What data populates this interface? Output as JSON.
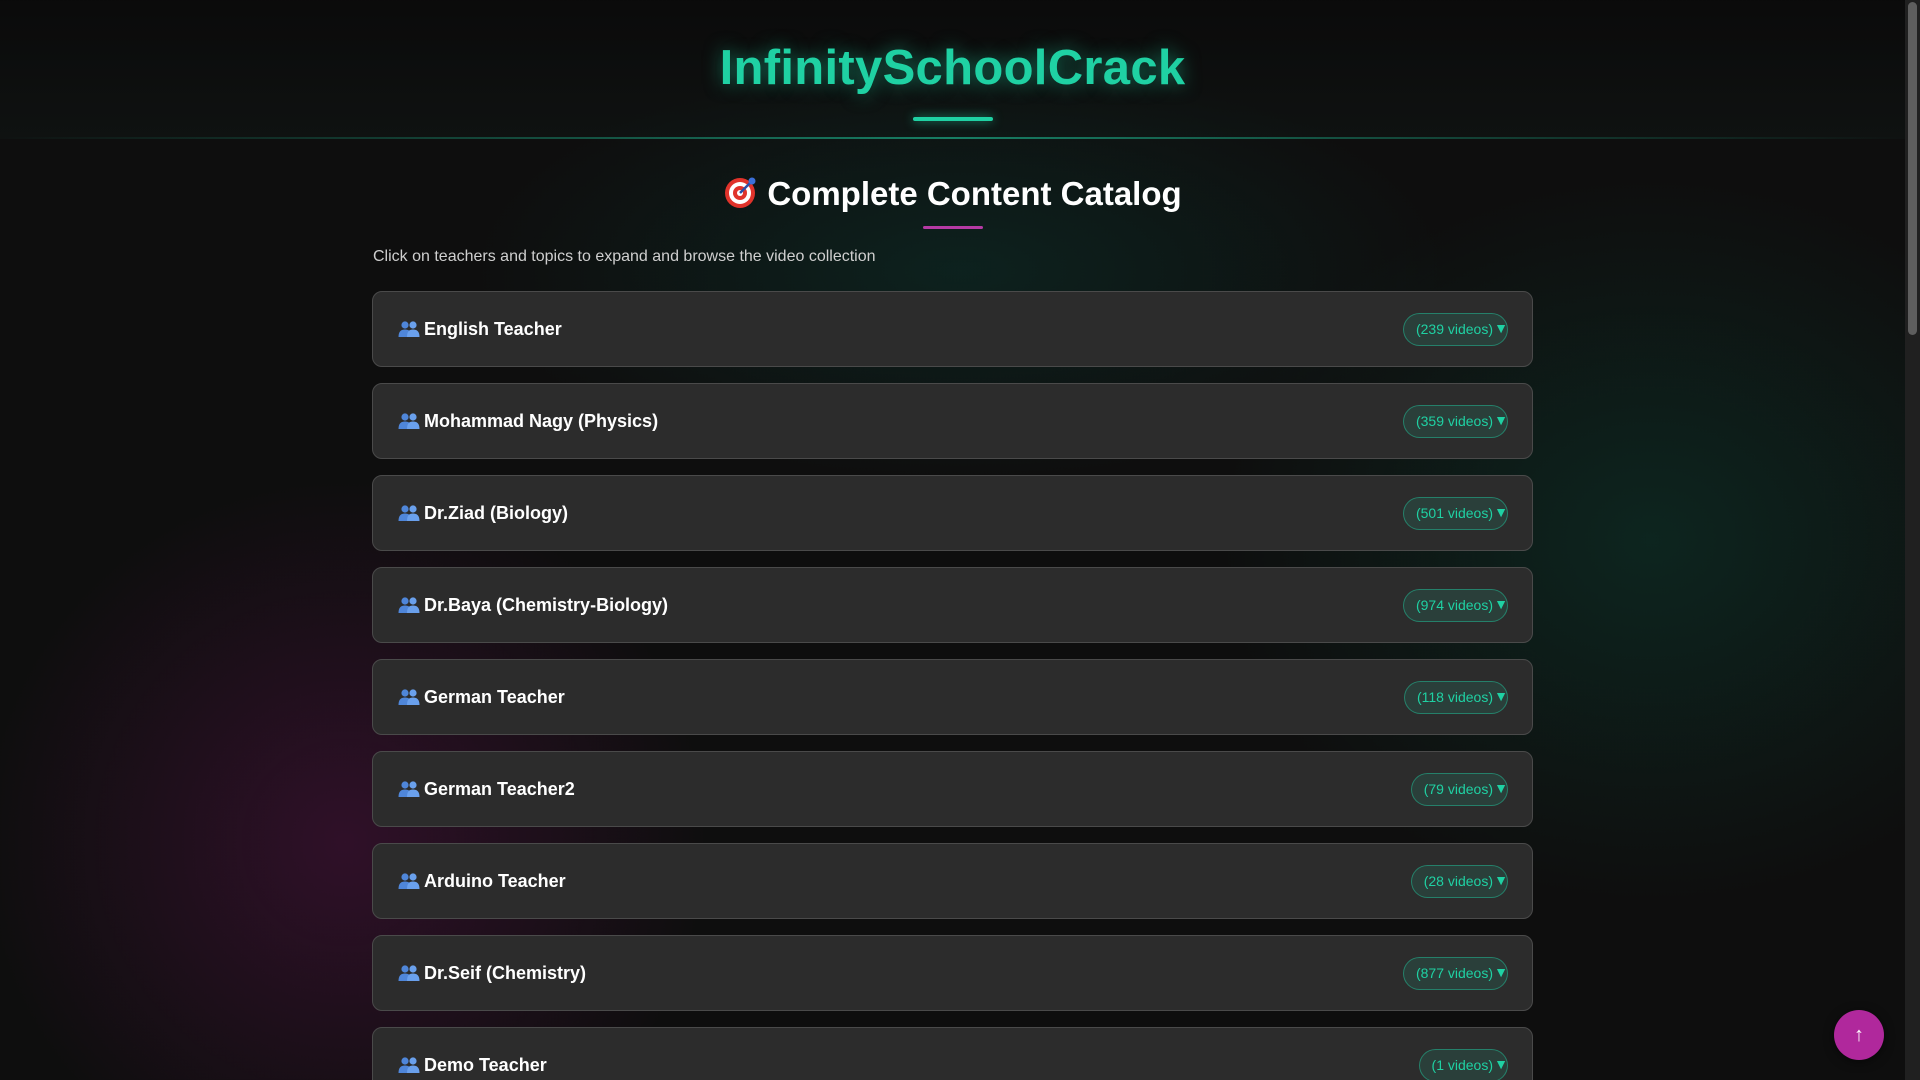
{
  "header": {
    "title": "InfinitySchoolCrack"
  },
  "catalog": {
    "title": "Complete Content Catalog",
    "title_icon": "target-icon",
    "subtitle": "Click on teachers and topics to expand and browse the video collection"
  },
  "teachers": [
    {
      "name": "English Teacher",
      "count": "(239 videos)"
    },
    {
      "name": "Mohammad Nagy (Physics)",
      "count": "(359 videos)"
    },
    {
      "name": "Dr.Ziad (Biology)",
      "count": "(501 videos)"
    },
    {
      "name": "Dr.Baya (Chemistry-Biology)",
      "count": "(974 videos)"
    },
    {
      "name": "German Teacher",
      "count": "(118 videos)"
    },
    {
      "name": "German Teacher2",
      "count": "(79 videos)"
    },
    {
      "name": "Arduino Teacher",
      "count": "(28 videos)"
    },
    {
      "name": "Dr.Seif (Chemistry)",
      "count": "(877 videos)"
    },
    {
      "name": "Demo Teacher",
      "count": "(1 videos)"
    }
  ],
  "teacher_icon": "people-icon",
  "expand_icon": "chevron-down-icon",
  "scroll_top": {
    "label": "↑"
  },
  "colors": {
    "accent": "#1fd1a3",
    "secondary": "#b0289c",
    "card_bg": "#2c2c2c",
    "page_bg": "#0e0e0e"
  }
}
